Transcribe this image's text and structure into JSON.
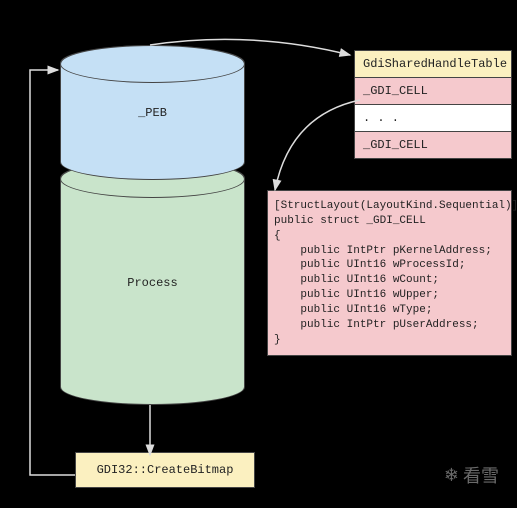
{
  "cylinder": {
    "top_label": "_PEB",
    "bottom_label": "Process"
  },
  "table": {
    "header": "GdiSharedHandleTable",
    "rows": [
      "_GDI_CELL",
      ". . .",
      "_GDI_CELL"
    ]
  },
  "code": {
    "lines": [
      "[StructLayout(LayoutKind.Sequential)]",
      "public struct _GDI_CELL",
      "{",
      "    public IntPtr pKernelAddress;",
      "    public UInt16 wProcessId;",
      "    public UInt16 wCount;",
      "    public UInt16 wUpper;",
      "    public UInt16 wType;",
      "    public IntPtr pUserAddress;",
      "}"
    ]
  },
  "bottom_box": {
    "label": "GDI32::CreateBitmap"
  },
  "watermark": {
    "text": "看雪",
    "icon": "❄"
  }
}
